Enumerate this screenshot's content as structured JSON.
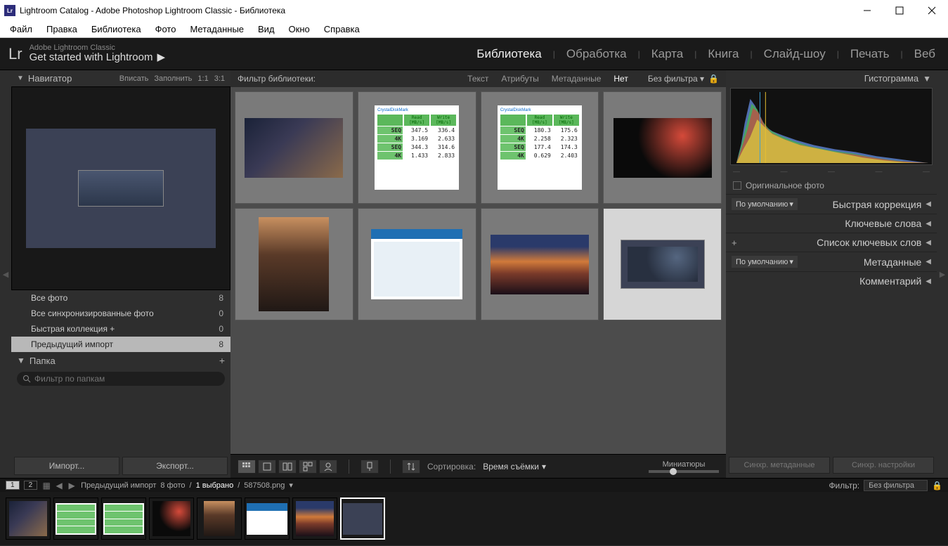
{
  "window": {
    "title": "Lightroom Catalog - Adobe Photoshop Lightroom Classic - Библиотека"
  },
  "menu": {
    "items": [
      "Файл",
      "Правка",
      "Библиотека",
      "Фото",
      "Метаданные",
      "Вид",
      "Окно",
      "Справка"
    ]
  },
  "identity": {
    "brand": "Lr",
    "sub": "Adobe Lightroom Classic",
    "getstarted": "Get started with Lightroom"
  },
  "modules": {
    "items": [
      "Библиотека",
      "Обработка",
      "Карта",
      "Книга",
      "Слайд-шоу",
      "Печать",
      "Веб"
    ],
    "active_idx": 0
  },
  "navigator": {
    "title": "Навигатор",
    "opts": [
      "Вписать",
      "Заполнить",
      "1:1",
      "3:1"
    ]
  },
  "catalog": {
    "rows": [
      {
        "label": "Все фото",
        "count": 8
      },
      {
        "label": "Все синхронизированные фото",
        "count": 0
      },
      {
        "label": "Быстрая коллекция  +",
        "count": 0
      },
      {
        "label": "Предыдущий импорт",
        "count": 8
      }
    ],
    "selected_idx": 3
  },
  "folders": {
    "title": "Папка",
    "search_placeholder": "Фильтр по папкам"
  },
  "left_buttons": {
    "import": "Импорт...",
    "export": "Экспорт..."
  },
  "filterbar": {
    "label": "Фильтр библиотеки:",
    "tabs": [
      "Текст",
      "Атрибуты",
      "Метаданные",
      "Нет"
    ],
    "active_idx": 3,
    "preset": "Без фильтра"
  },
  "bench1": {
    "header_read": "Read [MB/s]",
    "header_write": "Write [MB/s]",
    "rows": [
      {
        "l": "SEQ",
        "r": "347.5",
        "w": "336.4"
      },
      {
        "l": "4K",
        "r": "3.169",
        "w": "2.633"
      },
      {
        "l": "SEQ",
        "r": "344.3",
        "w": "314.6"
      },
      {
        "l": "4K",
        "r": "1.433",
        "w": "2.833"
      }
    ]
  },
  "bench2": {
    "header_read": "Read [MB/s]",
    "header_write": "Write [MB/s]",
    "rows": [
      {
        "l": "SEQ",
        "r": "180.3",
        "w": "175.6"
      },
      {
        "l": "4K",
        "r": "2.258",
        "w": "2.323"
      },
      {
        "l": "SEQ",
        "r": "177.4",
        "w": "174.3"
      },
      {
        "l": "4K",
        "r": "0.629",
        "w": "2.403"
      }
    ]
  },
  "toolbar": {
    "sort_label": "Сортировка:",
    "sort_value": "Время съёмки",
    "thumbsize": "Миниатюры"
  },
  "histogram": {
    "title": "Гистограмма",
    "orig": "Оригинальное фото"
  },
  "right_sections": {
    "quick": "Быстрая коррекция",
    "keywords": "Ключевые слова",
    "keyword_list": "Список ключевых слов",
    "metadata": "Метаданные",
    "comments": "Комментарий",
    "default1": "По умолчанию",
    "default2": "По умолчанию"
  },
  "sync": {
    "meta": "Синхр. метаданные",
    "settings": "Синхр. настройки"
  },
  "status": {
    "crumbs": "Предыдущий импорт",
    "photos": "8 фото",
    "selected": "1 выбрано",
    "filename": "587508.png",
    "filter_label": "Фильтр:",
    "filter_value": "Без фильтра"
  }
}
